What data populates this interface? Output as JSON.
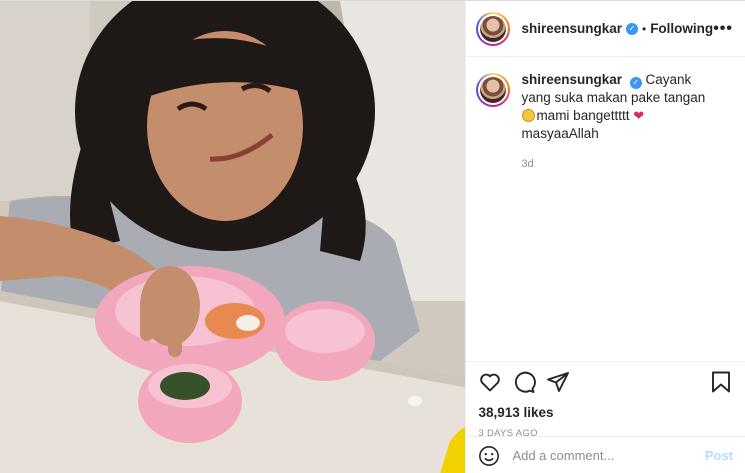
{
  "post": {
    "username": "shireensungkar",
    "follow_status": "Following",
    "more_label": "•••",
    "caption": {
      "username": "shireensungkar",
      "text_part1": "Cayank yang suka makan pake tangan",
      "text_part2": "mami bangettttt",
      "text_part3": "masyaaAllah",
      "time": "3d"
    },
    "likes": "38,913 likes",
    "date": "3 DAYS AGO",
    "comment_placeholder": "Add a comment...",
    "post_label": "Post"
  },
  "colors": {
    "verified": "#3897f0",
    "post_button": "#b2dffc",
    "heart_emoji": "#e0245e"
  }
}
